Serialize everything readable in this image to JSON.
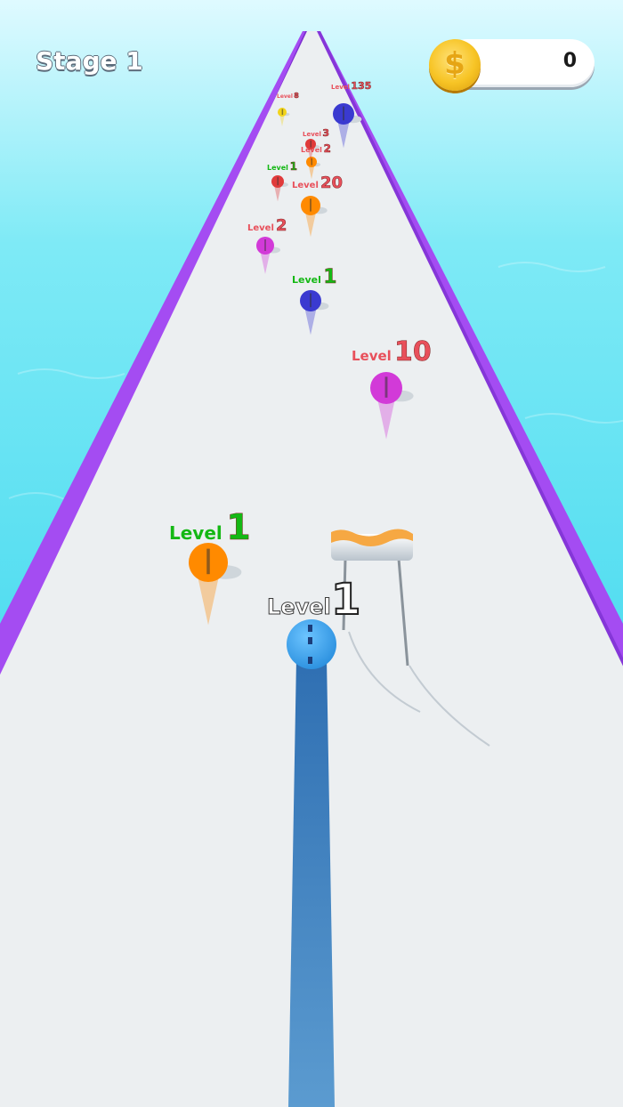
{
  "hud": {
    "stage_label": "Stage 1",
    "coins": "0",
    "coin_symbol": "$"
  },
  "colors": {
    "track": "#eceff1",
    "rail": "#a44cf2",
    "water": "#59dff2",
    "player": "#3aa6ee",
    "player_trail": "#3b7fc0"
  },
  "player": {
    "level_word": "Level",
    "level_num": "1"
  },
  "enemies": [
    {
      "id": "orange-1",
      "color": "#ff8a00",
      "level_word": "Level",
      "level_num": "1",
      "label_color": "#14b814"
    },
    {
      "id": "magenta-10",
      "color": "#d23ad8",
      "level_word": "Level",
      "level_num": "10",
      "label_color": "#e8505b"
    },
    {
      "id": "blue-1",
      "color": "#3a3ad0",
      "level_word": "Level",
      "level_num": "1",
      "label_color": "#14b814"
    },
    {
      "id": "magenta-2",
      "color": "#d23ad8",
      "level_word": "Level",
      "level_num": "2",
      "label_color": "#e8505b"
    },
    {
      "id": "orange-20",
      "color": "#ff8a00",
      "level_word": "Level",
      "level_num": "20",
      "label_color": "#e8505b"
    },
    {
      "id": "red-1",
      "color": "#e03a3a",
      "level_word": "Level",
      "level_num": "1",
      "label_color": "#14b814"
    },
    {
      "id": "orange-2",
      "color": "#ff8a00",
      "level_word": "Level",
      "level_num": "2",
      "label_color": "#e8505b"
    },
    {
      "id": "red-3",
      "color": "#e03a3a",
      "level_word": "Level",
      "level_num": "3",
      "label_color": "#e8505b"
    },
    {
      "id": "blue-135",
      "color": "#3a3ad0",
      "level_word": "Level",
      "level_num": "135",
      "label_color": "#e8505b"
    },
    {
      "id": "yellow-8",
      "color": "#f2d41a",
      "level_word": "Level",
      "level_num": "8",
      "label_color": "#e8505b"
    }
  ]
}
